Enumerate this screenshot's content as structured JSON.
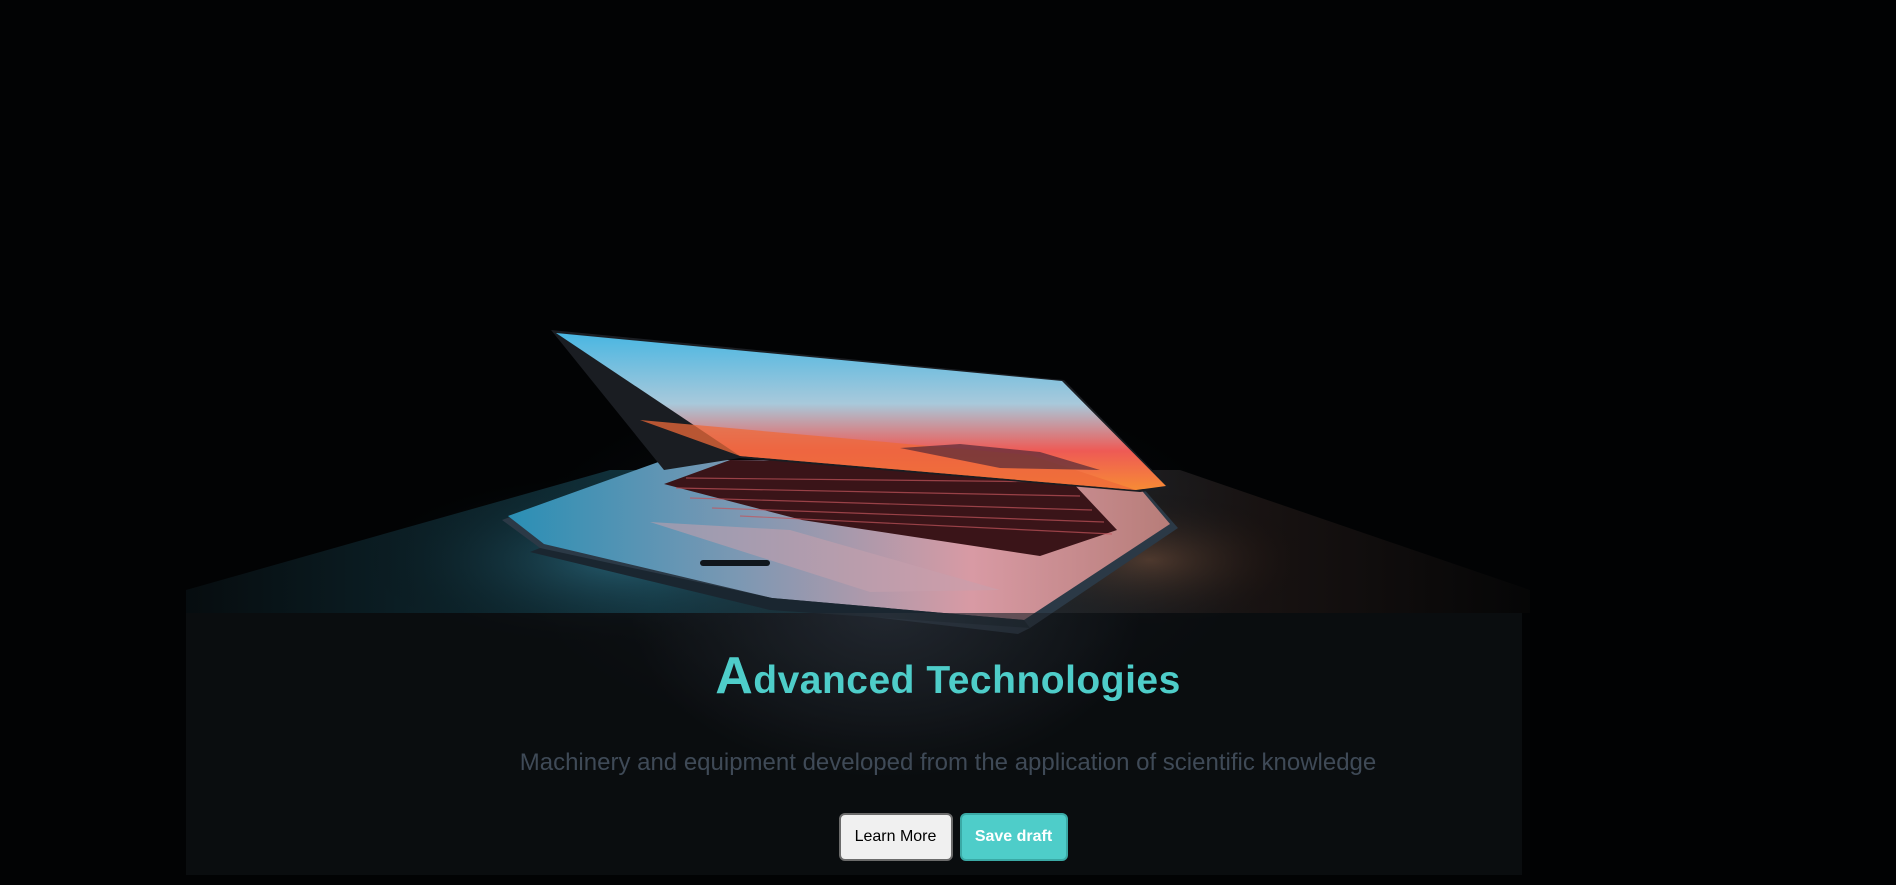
{
  "hero": {
    "image_icon": "laptop-photo",
    "title_first_letter": "A",
    "title_rest": "dvanced Technologies",
    "subtitle": "Machinery and equipment developed from the application of scientific knowledge"
  },
  "actions": {
    "learn_more_label": "Learn More",
    "save_draft_label": "Save draft"
  },
  "colors": {
    "accent": "#4ecdc9",
    "background": "#020304",
    "subtitle": "#3f4a57"
  }
}
